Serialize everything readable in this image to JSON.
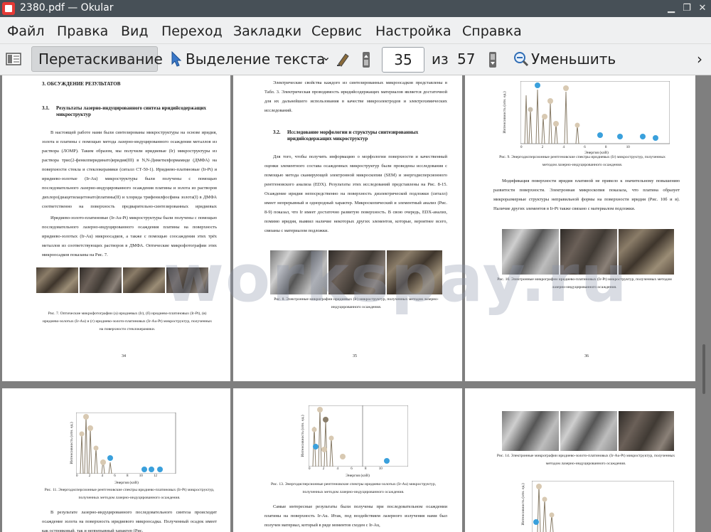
{
  "window": {
    "title": "2380.pdf  — Okular"
  },
  "menu": [
    "Файл",
    "Правка",
    "Вид",
    "Переход",
    "Закладки",
    "Сервис",
    "Настройка",
    "Справка"
  ],
  "toolbar": {
    "drag_label": "Перетаскивание",
    "select_label": "Выделение текста",
    "page_current": "35",
    "page_of": "из",
    "page_total": "57",
    "zoom_out_label": "Уменьшить"
  },
  "watermark": "workspay.ru",
  "pages": {
    "p34": {
      "heading": "3.   ОБСУЖДЕНИЕ РЕЗУЛЬТАТОВ",
      "subheading_num": "3.1.",
      "subheading": "Результаты лазерно-индуцированного синтеза иридийсодержащих микроструктур",
      "para1": "В настоящей работе нами были синтезированы микроструктуры на основе иридия, золота и платины с помощью метода лазерно-индуцированного осаждения металлов из раствора (ЛОМР). Таким образом, мы получили иридиевые (Ir) микроструктуры из раствора трис(2-фенилпиридинато)иридия(III) в N,N-Диметилформамиде (ДМФА) на поверхности стекла и стеклокерамики (ситалл СТ-50-1). Иридиево-платиновые (Ir-Pt) и иридиево-золотые (Ir-Au) микроструктуры были получены с помощью последовательного лазерно-индуцированного осаждения платины и золота из растворов дихлоро(диацетилацетонато)платины(II) и хлорида трифенилфосфина золота(I) в ДМФА соответственно на поверхность предварительно-синтезированных иридиевых микроосадков.",
      "para2": "Иридиево-золото-платиновые (Ir-Au-Pt) микроструктуры были получены с помощью последовательного лазерно-индуцированного осаждения платины на поверхность иридиево-золотых (Ir-Au) микроосадков, а также с помощью соосаждения этих трёх металлов из соответствующих растворов в ДМФА. Оптические микрофотографии этих микроосадков показаны на Рис. 7.",
      "caption": "Рис. 7. Оптические микрофотографии (а) иридиевых (Ir), (б) иридиево-платиновых (Ir-Pt), (в) иридиево-золотых (Ir-Au) и (г) иридиево-золото-платиновых (Ir-Au-Pt) микроструктур, полученных на поверхности стеклокерамики.",
      "page_number": "34"
    },
    "p35": {
      "para1": "Электрические свойства каждого из синтезированных микроосадков представлены в Табл. 3. Электрическая проводимость иридийсодержащих материалов является достаточной для их дальнейшего использования в качестве микроэлектродов и электрохимических исследований.",
      "subheading_num": "3.2.",
      "subheading": "Исследование морфологии и структуры синтезированных иридийсодержащих микроструктур",
      "para2": "Для того, чтобы получить информацию о морфологии поверхности и качественный оценки элементного состава осажденных микроструктур были проведены исследования с помощью метода сканирующей электронной микроскопии (SEM) и энергодисперсионного рентгеновского анализа (EDX). Результаты этих исследований представлены на Рис. 8-15. Осаждение иридия непосредственно на поверхность диэлектрической подложки (ситалл) имеет непрерывный и однородный характер. Микроскопический и элементный анализ (Рис. 8-9) показал, что Ir имеет достаточно развитую поверхность. В свою очередь, EDX-анализ, помимо иридия, выявил наличие некоторых других элементов, которые, вероятнее всего, связаны с материалом подложки.",
      "caption": "Рис. 8. Электронные микрографии иридиевых (Ir) микроструктур, полученных методом лазерно-индуцированного осаждения.",
      "page_number": "35"
    },
    "p36": {
      "y_axis_label": "Интенсивность (отн. ед.)",
      "x_axis_label": "Энергия (кэВ)",
      "x_ticks": [
        "0",
        "2",
        "4",
        "6",
        "8",
        "10"
      ],
      "caption": "Рис. 9. Энергодисперсионные рентгеновские спектры иридиевых (Ir) микроструктур, полученных методом лазерно-индуцированного осаждения.",
      "para1": "Модификация поверхности иридия платиной не привело к значительному повышению развитости поверхности. Электронная микроскопия показала, что платина образует микроразмерные структуры неправильной формы на поверхности иридия (Рис. 10б и в). Наличие других элементов в Ir-Pt также связано с материалом подложки.",
      "caption2": "Рис. 10. Электронные микрографии иридиево-платиновых (Ir-Pt) микроструктур, полученных методом лазерно-индуцированного осаждения.",
      "page_number": "36"
    },
    "p37": {
      "y_axis_label": "Интенсивность (отн. ед.)",
      "x_axis_label": "Энергия (кэВ)",
      "x_ticks": [
        "0",
        "2",
        "4",
        "6",
        "8",
        "10",
        "12"
      ],
      "caption": "Рис. 11. Энергодисперсионные рентгеновские спектры иридиево-платиновых (Ir-Pt) микроструктур, полученных методом лазерно-индуцированного осаждения.",
      "para1": "В результате лазерно-индуцированного последовательного синтеза происходит осаждение золота на поверхность иридиевого микроосадка. Полученный осадок имеет как островковый, так и непрерывный характер (Рис."
    },
    "p38": {
      "y_axis_label": "Интенсивность (отн. ед.)",
      "x_axis_label": "Энергия (кэВ)",
      "x_ticks": [
        "0",
        "2",
        "4",
        "6",
        "8",
        "10"
      ],
      "caption": "Рис. 13. Энергодисперсионные рентгеновские спектры иридиево-золотых (Ir-Au) микроструктур, полученных методом лазерно-индуцированного осаждения.",
      "para1": "Самые интересные результаты были получены при последовательном осаждении платины на поверхность Ir-Au. Итак, под воздействием лазерного излучения нами был получен материал, который в ряде моментов сходен с Ir-Au,"
    },
    "p39": {
      "caption": "Рис. 14. Электронные микрографии иридиево-золото-платиновых (Ir-Au-Pt) микроструктур, полученных методом лазерно-индуцированного осаждения.",
      "y_axis_label": "Интенсивность (отн. ед.)"
    }
  }
}
